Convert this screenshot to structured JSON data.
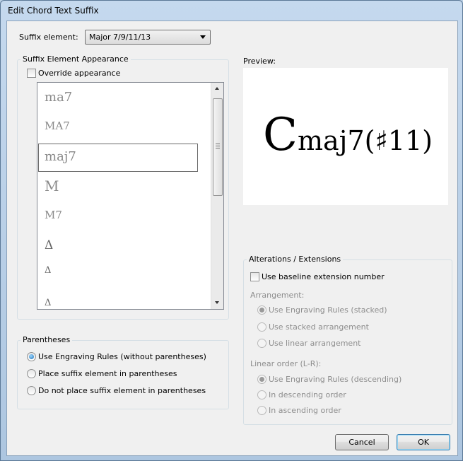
{
  "window": {
    "title": "Edit Chord Text Suffix"
  },
  "suffix_element": {
    "label": "Suffix element:",
    "value": "Major 7/9/11/13"
  },
  "appearance": {
    "group_title": "Suffix Element Appearance",
    "override_label": "Override appearance",
    "override_checked": false,
    "items": [
      "ma7",
      "MA7",
      "maj7",
      "M",
      "M7",
      "Δ",
      "Δ",
      "Δ"
    ],
    "selected_index": 2
  },
  "preview": {
    "label": "Preview:",
    "root": "C",
    "suffix": "maj7(♯11)"
  },
  "parentheses": {
    "group_title": "Parentheses",
    "options": [
      "Use Engraving Rules (without parentheses)",
      "Place suffix element in parentheses",
      "Do not place suffix element in parentheses"
    ],
    "selected_index": 0
  },
  "alterations": {
    "group_title": "Alterations / Extensions",
    "baseline_label": "Use baseline extension number",
    "baseline_checked": false,
    "arrangement_label": "Arrangement:",
    "arrangement_options": [
      "Use Engraving Rules (stacked)",
      "Use stacked arrangement",
      "Use linear arrangement"
    ],
    "arrangement_selected": 0,
    "order_label": "Linear order (L-R):",
    "order_options": [
      "Use Engraving Rules (descending)",
      "In descending order",
      "In ascending order"
    ],
    "order_selected": 0
  },
  "buttons": {
    "cancel": "Cancel",
    "ok": "OK"
  }
}
